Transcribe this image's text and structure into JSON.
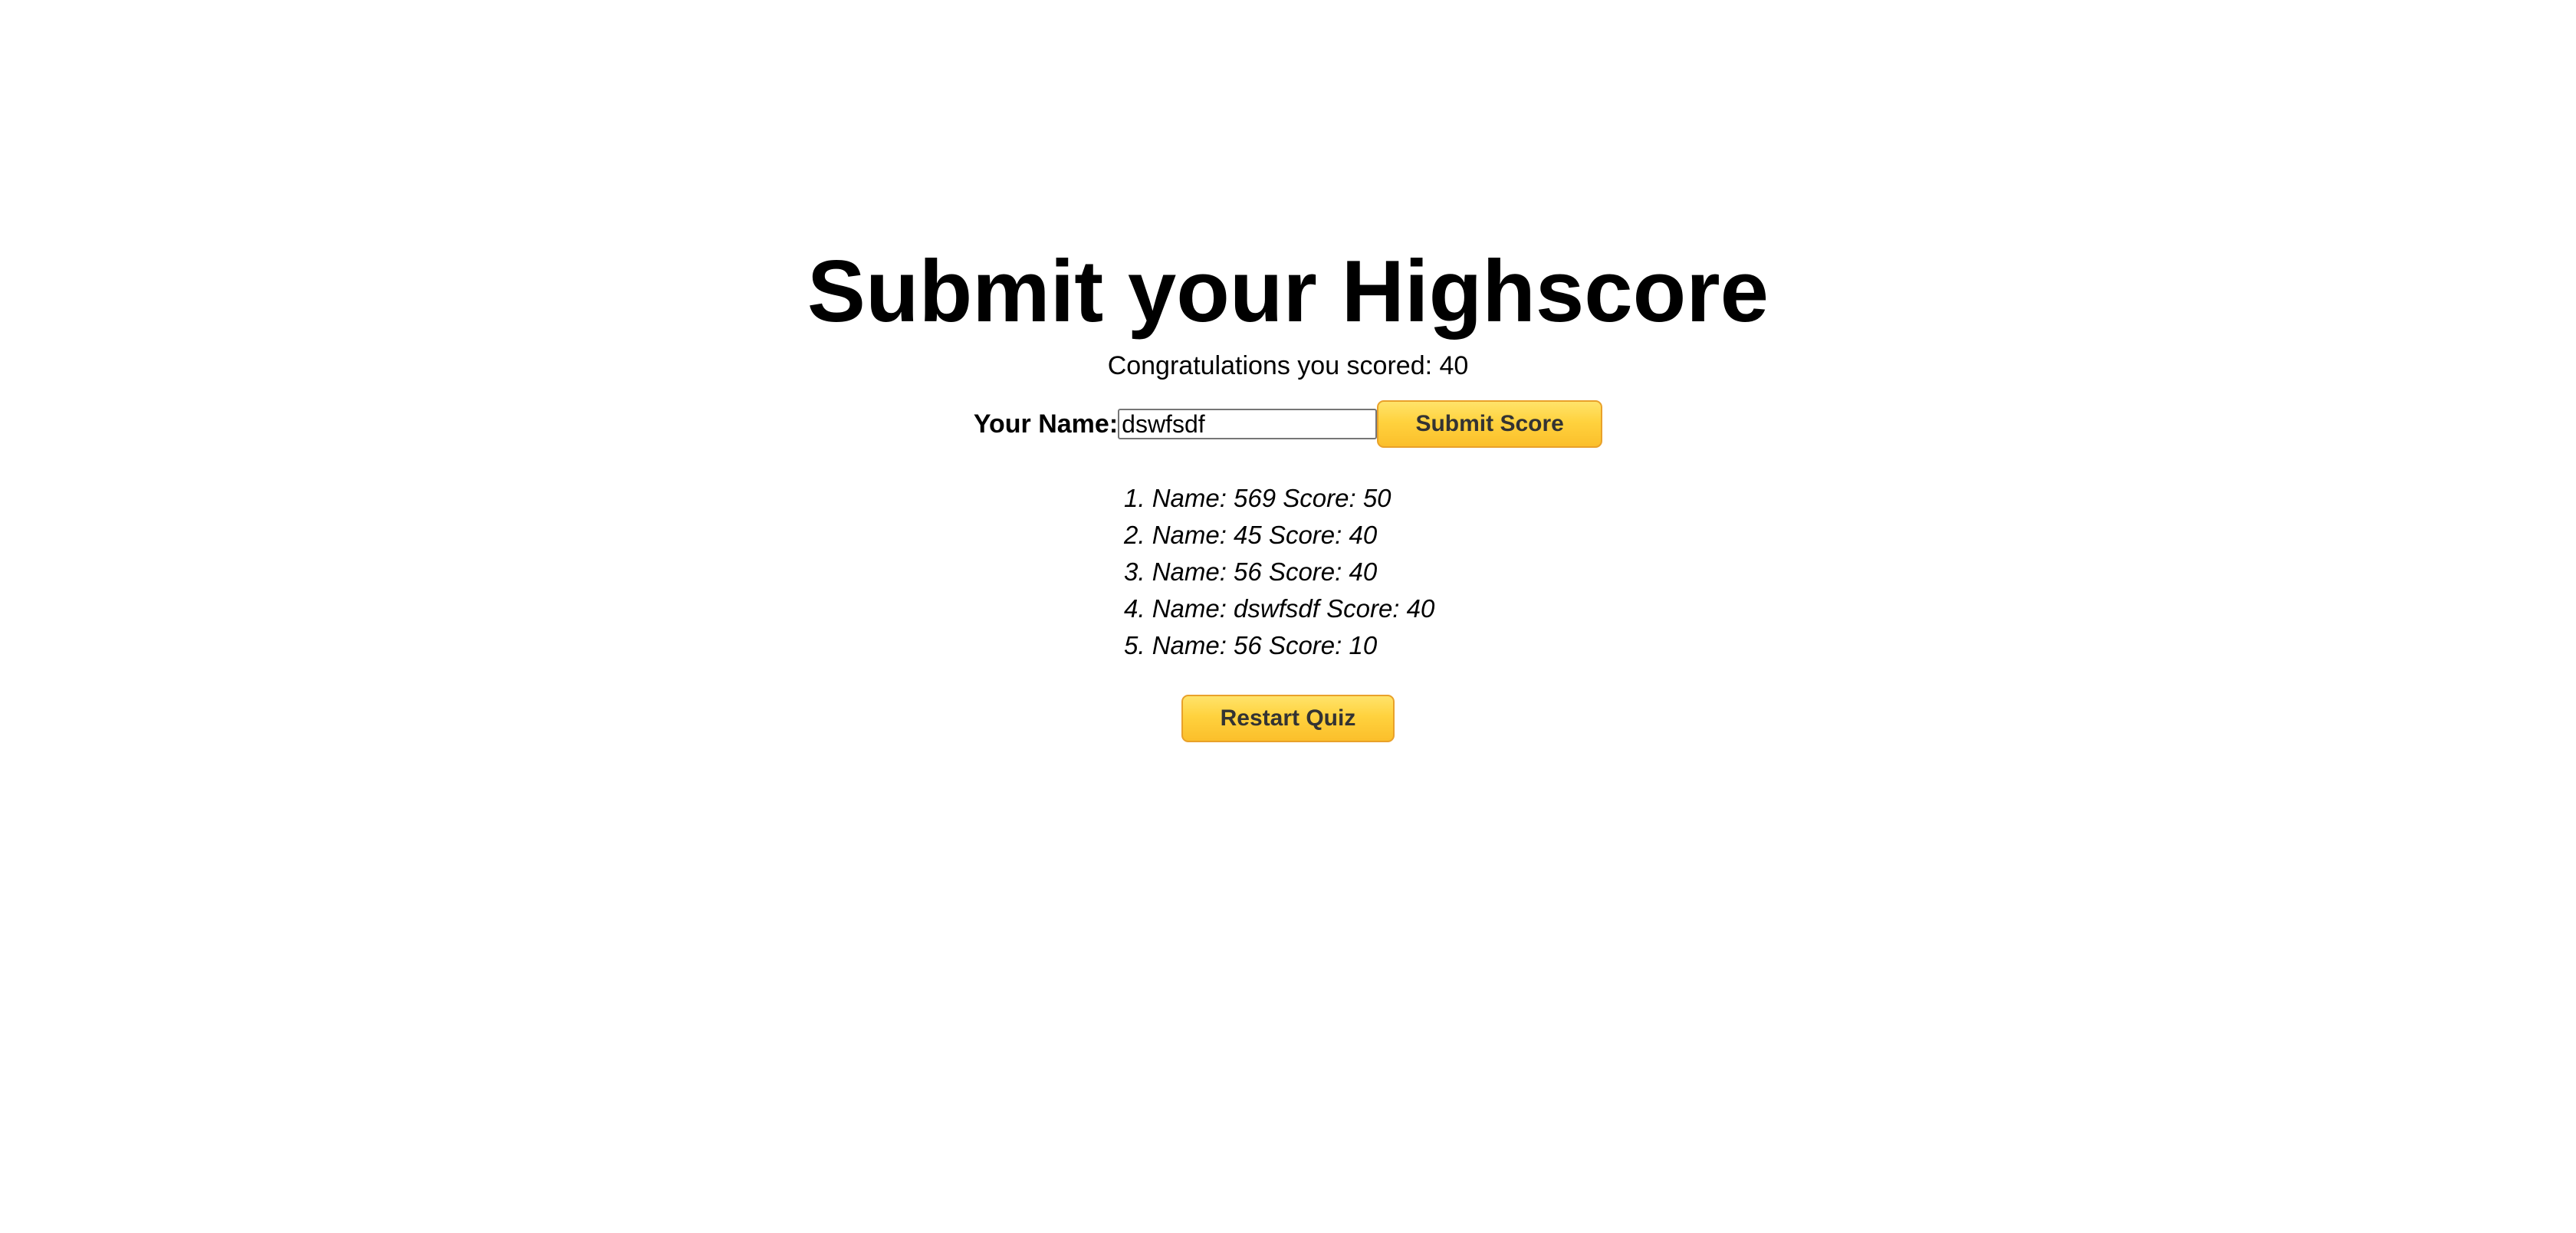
{
  "title": "Submit your Highscore",
  "congrats": "Congratulations you scored: 40",
  "form": {
    "name_label": "Your Name:",
    "name_value": "dswfsdf",
    "submit_label": "Submit Score"
  },
  "highscores": [
    "1. Name: 569 Score: 50",
    "2. Name: 45 Score: 40",
    "3. Name: 56 Score: 40",
    "4. Name: dswfsdf Score: 40",
    "5. Name: 56 Score: 10"
  ],
  "restart_label": "Restart Quiz",
  "colors": {
    "button_gold": "#ffd23e",
    "button_border": "#e9a12a",
    "button_text": "#333333"
  }
}
